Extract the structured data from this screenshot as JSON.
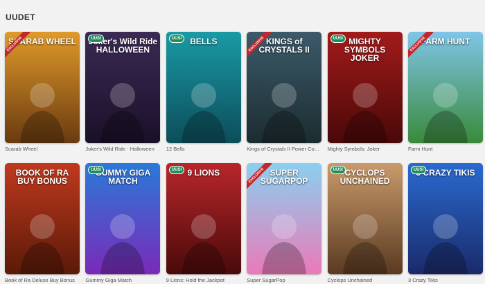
{
  "section": {
    "title": "UUDET"
  },
  "games": [
    {
      "name": "Scarab Wheel",
      "logo": "SCARAB WHEEL",
      "badge": "",
      "ribbon": "EXCLUSIVE",
      "bg1": "#e09a2a",
      "bg2": "#6a3a10"
    },
    {
      "name": "Joker's Wild Ride - Halloween",
      "logo": "Joker's Wild Ride HALLOWEEN",
      "badge": "UUSI",
      "ribbon": "",
      "bg1": "#3b2a55",
      "bg2": "#1a1028"
    },
    {
      "name": "12 Bells",
      "logo": "BELLS",
      "badge": "UUSI",
      "ribbon": "",
      "bg1": "#1a9aa6",
      "bg2": "#0c4d5a"
    },
    {
      "name": "Kings of Crystals II Power Combo",
      "logo": "KINGS of CRYSTALS II",
      "badge": "",
      "ribbon": "EXCLUSIVE",
      "bg1": "#3c5a6a",
      "bg2": "#1c2c30"
    },
    {
      "name": "Mighty Symbols: Joker",
      "logo": "MIGHTY SYMBOLS JOKER",
      "badge": "UUSI",
      "ribbon": "",
      "bg1": "#a31b1b",
      "bg2": "#4a0808"
    },
    {
      "name": "Farm Hunt",
      "logo": "FARM HUNT",
      "badge": "",
      "ribbon": "EXCLUSIVE",
      "bg1": "#7fc5e8",
      "bg2": "#3a8a3a"
    },
    {
      "name": "Book of Ra Deluxe Buy Bonus",
      "logo": "BOOK OF RA BUY BONUS",
      "badge": "",
      "ribbon": "",
      "bg1": "#c0391e",
      "bg2": "#5a1a08"
    },
    {
      "name": "Gummy Giga Match",
      "logo": "GUMMY GIGA MATCH",
      "badge": "UUSI",
      "ribbon": "",
      "bg1": "#2a7ad8",
      "bg2": "#7a2ab8"
    },
    {
      "name": "9 Lions: Hold the Jackpot",
      "logo": "9 LIONS",
      "badge": "UUSI",
      "ribbon": "",
      "bg1": "#b8262a",
      "bg2": "#4a0a0a"
    },
    {
      "name": "Super SugarPop",
      "logo": "SUPER SUGARPOP",
      "badge": "",
      "ribbon": "EXCLUSIVE",
      "bg1": "#8ad0f0",
      "bg2": "#ea7ab8"
    },
    {
      "name": "Cyclops Unchained",
      "logo": "CYCLOPS UNCHAINED",
      "badge": "UUSI",
      "ribbon": "",
      "bg1": "#c99a6a",
      "bg2": "#5a3a22"
    },
    {
      "name": "3 Crazy Tikis",
      "logo": "3 CRAZY TIKIS",
      "badge": "UUSI",
      "ribbon": "",
      "bg1": "#2a6ad0",
      "bg2": "#1a2a6a"
    }
  ]
}
